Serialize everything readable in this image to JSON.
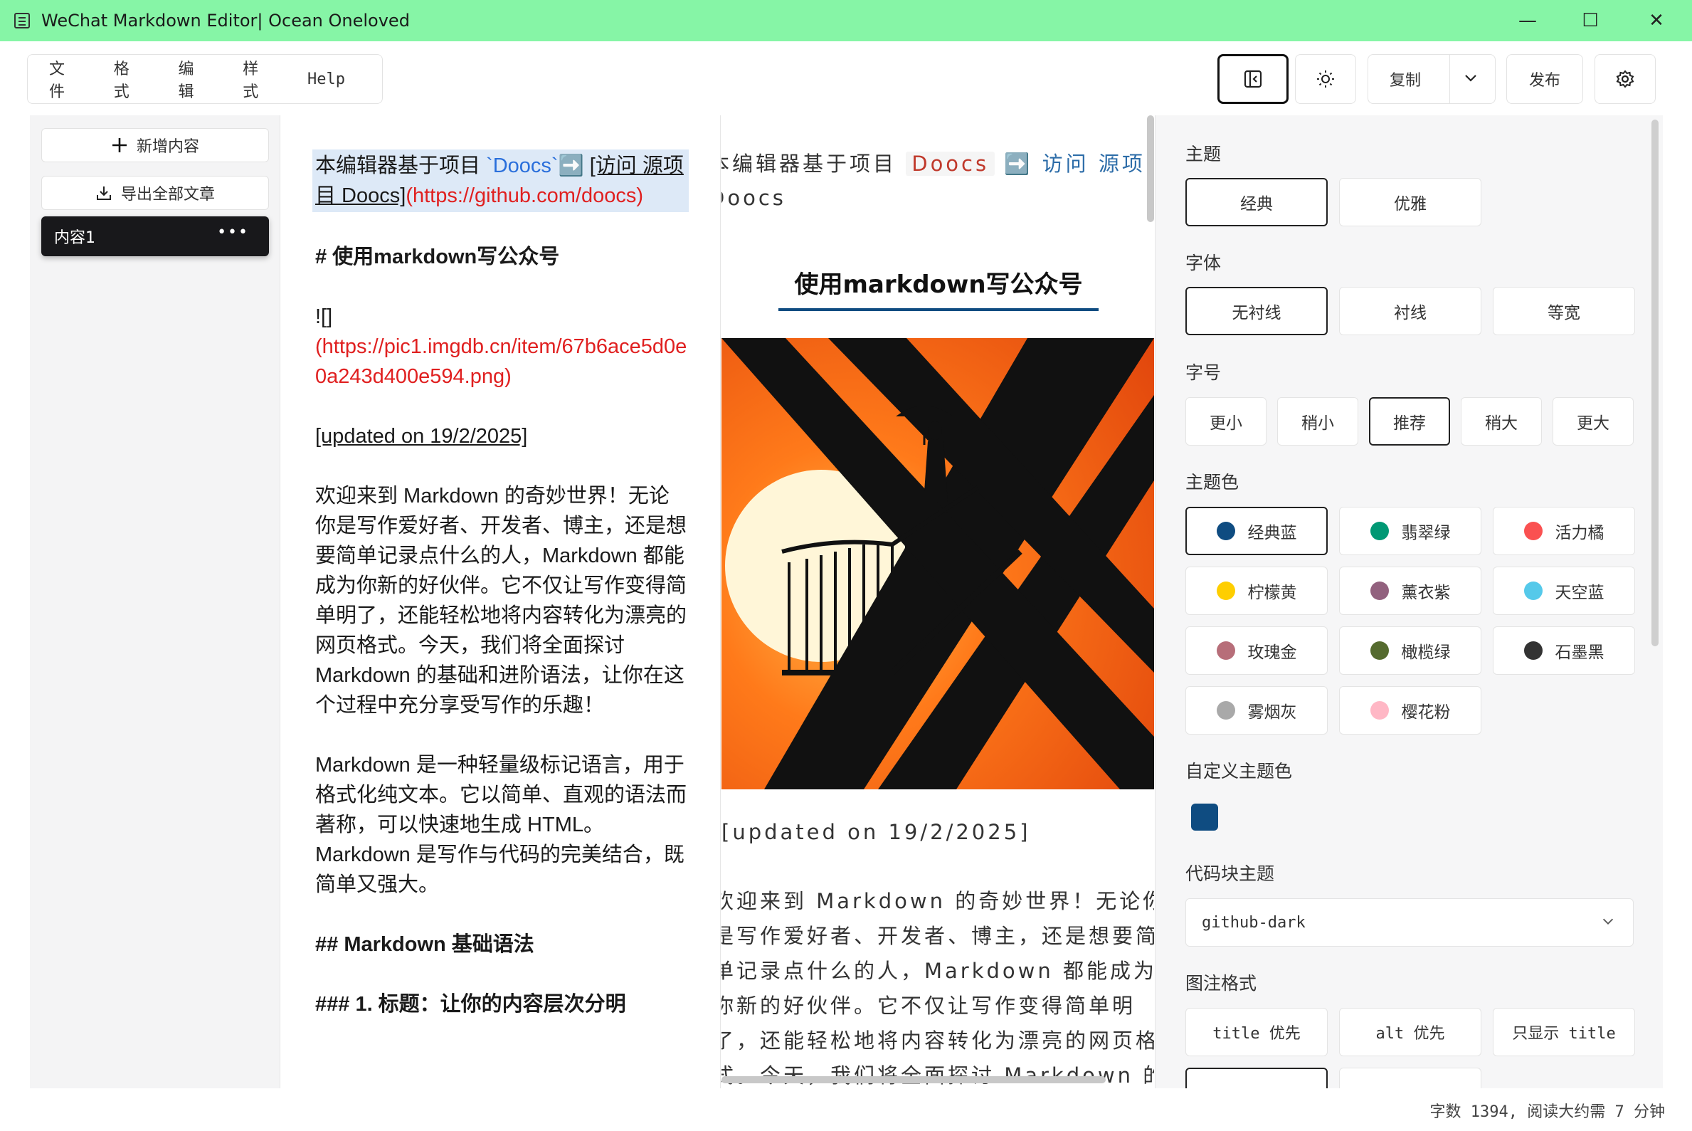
{
  "window": {
    "title": "WeChat Markdown Editor| Ocean Oneloved"
  },
  "menu": {
    "items": [
      "文件",
      "格式",
      "编辑",
      "样式",
      "Help"
    ]
  },
  "toolbar": {
    "copy_label": "复制",
    "publish_label": "发布"
  },
  "sidebar": {
    "add_label": "新增内容",
    "export_label": "导出全部文章",
    "items": [
      {
        "label": "内容1"
      }
    ]
  },
  "editor": {
    "intro_pre": "本编辑器基于项目 ",
    "intro_code": "`Doocs`",
    "intro_arrow": "➡️",
    "intro_link_text": "[访问 源项目 Doocs]",
    "intro_link_url": "(https://github.com/doocs)",
    "h1": "# 使用markdown写公众号",
    "img_alt": "![]",
    "img_url": "(https://pic1.imgdb.cn/item/67b6ace5d0e0a243d400e594.png)",
    "updated": "[updated on 19/2/2025]",
    "para1": "欢迎来到 Markdown 的奇妙世界！无论你是写作爱好者、开发者、博主，还是想要简单记录点什么的人，Markdown 都能成为你新的好伙伴。它不仅让写作变得简单明了，还能轻松地将内容转化为漂亮的网页格式。今天，我们将全面探讨 Markdown 的基础和进阶语法，让你在这个过程中充分享受写作的乐趣！",
    "para2": "Markdown 是一种轻量级标记语言，用于格式化纯文本。它以简单、直观的语法而著称，可以快速地生成 HTML。Markdown 是写作与代码的完美结合，既简单又强大。",
    "h2": "## Markdown 基础语法",
    "h3": "### 1. 标题：让你的内容层次分明"
  },
  "preview": {
    "intro_pre": "本编辑器基于项目",
    "intro_code": "Doocs",
    "intro_arrow": "➡️",
    "intro_link": "访问 源项目",
    "intro_line2": "Doocs",
    "title": "使用markdown写公众号",
    "updated": "[updated on 19/2/2025]",
    "body": "欢迎来到 Markdown 的奇妙世界！无论你是写作爱好者、开发者、博主，还是想要简单记录点什么的人，Markdown 都能成为你新的好伙伴。它不仅让写作变得简单明了，还能轻松地将内容转化为漂亮的网页格式。今天，我们将全面探讨 Markdown 的基础和进阶语法"
  },
  "settings": {
    "theme_label": "主题",
    "themes": [
      "经典",
      "优雅"
    ],
    "font_label": "字体",
    "fonts": [
      "无衬线",
      "衬线",
      "等宽"
    ],
    "size_label": "字号",
    "sizes": [
      "更小",
      "稍小",
      "推荐",
      "稍大",
      "更大"
    ],
    "color_label": "主题色",
    "colors": [
      {
        "name": "经典蓝",
        "hex": "#0f4c81"
      },
      {
        "name": "翡翠绿",
        "hex": "#009874"
      },
      {
        "name": "活力橘",
        "hex": "#fa5151"
      },
      {
        "name": "柠檬黄",
        "hex": "#fece00"
      },
      {
        "name": "薰衣紫",
        "hex": "#92617e"
      },
      {
        "name": "天空蓝",
        "hex": "#55c9ea"
      },
      {
        "name": "玫瑰金",
        "hex": "#b76e79"
      },
      {
        "name": "橄榄绿",
        "hex": "#556b2f"
      },
      {
        "name": "石墨黑",
        "hex": "#333333"
      },
      {
        "name": "雾烟灰",
        "hex": "#a9a9a9"
      },
      {
        "name": "樱花粉",
        "hex": "#ffb7c5"
      }
    ],
    "custom_color_label": "自定义主题色",
    "custom_color": "#0f4c81",
    "code_theme_label": "代码块主题",
    "code_theme": "github-dark",
    "caption_label": "图注格式",
    "captions": [
      "title 优先",
      "alt 优先",
      "只显示 title"
    ]
  },
  "status": {
    "text": "字数 1394, 阅读大约需 7 分钟"
  }
}
